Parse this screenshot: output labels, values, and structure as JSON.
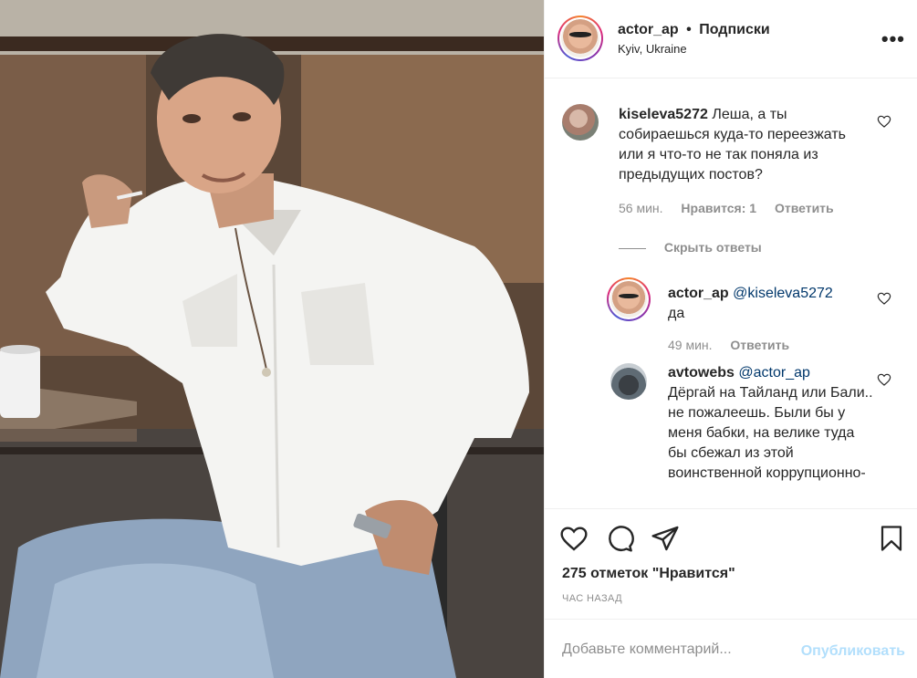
{
  "post": {
    "username": "actor_ap",
    "separator": "•",
    "follow_label": "Подписки",
    "location": "Kyiv, Ukraine",
    "more_icon": "more-horizontal-icon",
    "photo_subject": "man-in-white-shirt-photo"
  },
  "comments": [
    {
      "username": "kiseleva5272",
      "text": "Леша, а ты собираешься куда-то переезжать или я что-то не так поняла из предыдущих постов?",
      "time": "56 мин.",
      "likes_label": "Нравится: 1",
      "reply_label": "Ответить",
      "hide_replies_label": "Скрыть ответы"
    },
    {
      "username": "actor_ap",
      "mention": "@kiseleva5272",
      "text": "да",
      "time": "49 мин.",
      "reply_label": "Ответить"
    },
    {
      "username": "avtowebs",
      "mention": "@actor_ap",
      "text": "Дёргай на Тайланд или Бали.. не пожалеешь. Были бы у меня бабки, на велике туда бы сбежал из этой воинственной коррупционно-"
    }
  ],
  "actions": {
    "like_icon": "heart-icon",
    "comment_icon": "comment-icon",
    "share_icon": "share-icon",
    "save_icon": "bookmark-icon"
  },
  "likes_text": "275 отметок \"Нравится\"",
  "time_ago": "ЧАС НАЗАД",
  "add_comment": {
    "placeholder": "Добавьте комментарий...",
    "publish_label": "Опубликовать"
  },
  "colors": {
    "text": "#262626",
    "muted": "#8e8e8e",
    "mention": "#00376b",
    "publish_disabled": "#b2dffc",
    "border": "#efefef"
  }
}
